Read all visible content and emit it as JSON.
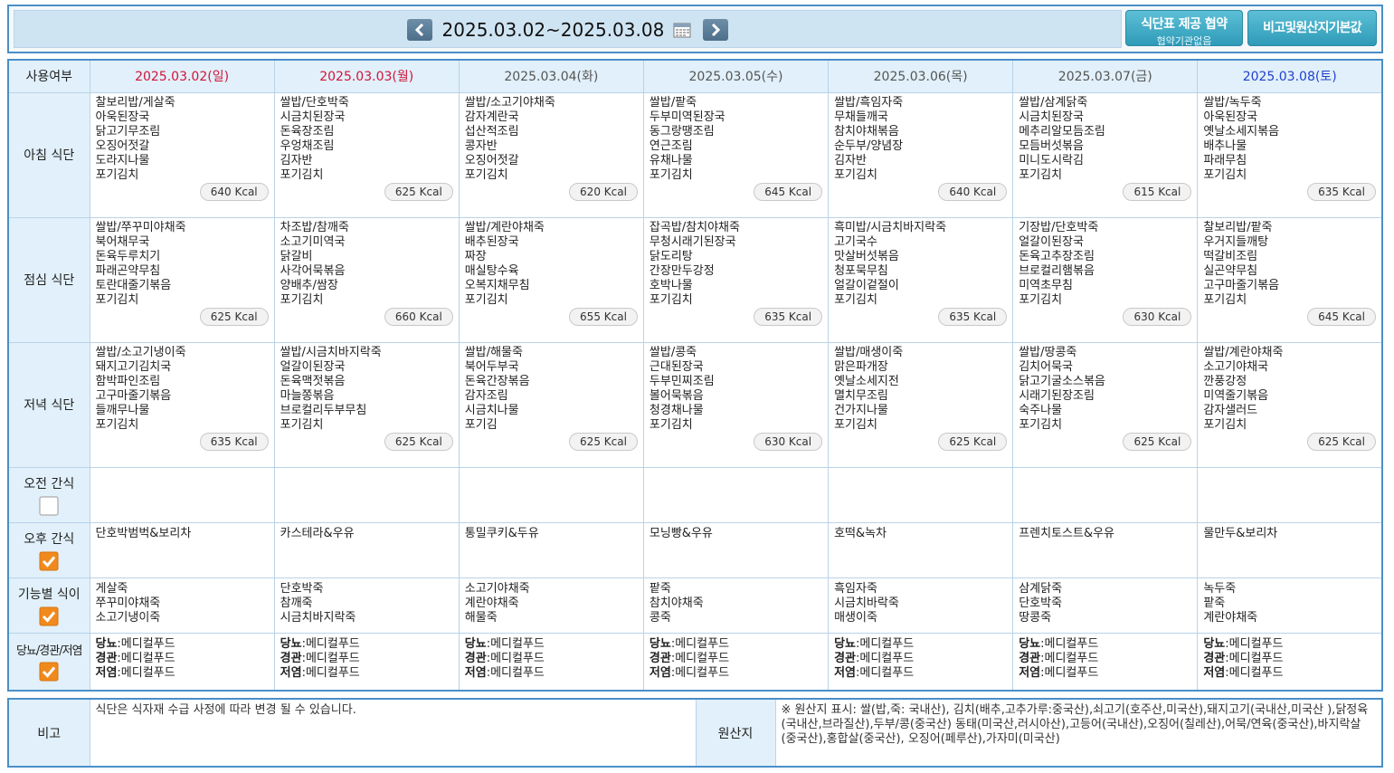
{
  "header": {
    "week_range": "2025.03.02~2025.03.08",
    "agreement_button_title": "식단표 제공 협약",
    "agreement_button_sub": "협약기관없음",
    "origin_default_button": "비고및원산지기본값"
  },
  "table": {
    "usage_label": "사용여부",
    "dates": [
      "2025.03.02(일)",
      "2025.03.03(월)",
      "2025.03.04(화)",
      "2025.03.05(수)",
      "2025.03.06(목)",
      "2025.03.07(금)",
      "2025.03.08(토)"
    ],
    "breakfast": {
      "label": "아침 식단",
      "days": [
        {
          "items": "찰보리밥/게살죽\n아욱된장국\n닭고기무조림\n오징어젓갈\n도라지나물\n포기김치",
          "kcal": "640 Kcal"
        },
        {
          "items": "쌀밥/단호박죽\n시금치된장국\n돈육장조림\n우엉채조림\n김자반\n포기김치",
          "kcal": "625 Kcal"
        },
        {
          "items": "쌀밥/소고기야채죽\n감자계란국\n섭산적조림\n콩자반\n오징어젓갈\n포기김치",
          "kcal": "620 Kcal"
        },
        {
          "items": "쌀밥/팥죽\n두부미역된장국\n동그랑땡조림\n연근조림\n유채나물\n포기김치",
          "kcal": "645 Kcal"
        },
        {
          "items": "쌀밥/흑임자죽\n무채들깨국\n참치야채볶음\n순두부/양념장\n김자반\n포기김치",
          "kcal": "640 Kcal"
        },
        {
          "items": "쌀밥/삼계닭죽\n시금치된장국\n메추리알모듬조림\n모듬버섯볶음\n미니도시락김\n포기김치",
          "kcal": "615 Kcal"
        },
        {
          "items": "쌀밥/녹두죽\n아욱된장국\n옛날소세지볶음\n배추나물\n파래무침\n포기김치",
          "kcal": "635 Kcal"
        }
      ]
    },
    "lunch": {
      "label": "점심 식단",
      "days": [
        {
          "items": "쌀밥/쭈꾸미야채죽\n북어채무국\n돈육두루치기\n파래곤약무침\n토란대줄기볶음\n포기김치",
          "kcal": "625 Kcal"
        },
        {
          "items": "차조밥/참깨죽\n소고기미역국\n닭갈비\n사각어묵볶음\n양배추/쌈장\n포기김치",
          "kcal": "660 Kcal"
        },
        {
          "items": "쌀밥/계란야채죽\n배추된장국\n짜장\n매실탕수육\n오복지채무침\n포기김치",
          "kcal": "655 Kcal"
        },
        {
          "items": "잡곡밥/참치야채죽\n무청시래기된장국\n닭도리탕\n간장만두강정\n호박나물\n포기김치",
          "kcal": "635 Kcal"
        },
        {
          "items": "흑미밥/시금치바지락죽\n고기국수\n맛살버섯볶음\n청포묵무침\n얼갈이겉절이\n포기김치",
          "kcal": "635 Kcal"
        },
        {
          "items": "기장밥/단호박죽\n얼갈이된장국\n돈육고추장조림\n브로컬리햄볶음\n미역초무침\n포기김치",
          "kcal": "630 Kcal"
        },
        {
          "items": "찰보리밥/팥죽\n우거지들깨탕\n떡갈비조림\n실곤약무침\n고구마줄기볶음\n포기김치",
          "kcal": "645 Kcal"
        }
      ]
    },
    "dinner": {
      "label": "저녁 식단",
      "days": [
        {
          "items": "쌀밥/소고기냉이죽\n돼지고기김치국\n함박파인조림\n고구마줄기볶음\n들깨무나물\n포기김치",
          "kcal": "635 Kcal"
        },
        {
          "items": "쌀밥/시금치바지락죽\n얼갈이된장국\n돈육맥젓볶음\n마늘쫑볶음\n브로컬리두부무침\n포기김치",
          "kcal": "625 Kcal"
        },
        {
          "items": "쌀밥/해물죽\n북어두부국\n돈육간장볶음\n감자조림\n시금치나물\n포기김",
          "kcal": "625 Kcal"
        },
        {
          "items": "쌀밥/콩죽\n근대된장국\n두부민찌조림\n볼어묵볶음\n청경채나물\n포기김치",
          "kcal": "630 Kcal"
        },
        {
          "items": "쌀밥/매생이죽\n맑은파개장\n옛날소세지전\n멸치무조림\n건가지나물\n포기김치",
          "kcal": "625 Kcal"
        },
        {
          "items": "쌀밥/땅콩죽\n김치어묵국\n닭고기굴소스볶음\n시래기된장조림\n숙주나물\n포기김치",
          "kcal": "625 Kcal"
        },
        {
          "items": "쌀밥/계란야채죽\n소고기야채국\n깐풍강정\n미역줄기볶음\n감자샐러드\n포기김치",
          "kcal": "625 Kcal"
        }
      ]
    },
    "morning_snack": {
      "label": "오전 간식",
      "checked": false,
      "days": [
        "",
        "",
        "",
        "",
        "",
        "",
        ""
      ]
    },
    "afternoon_snack": {
      "label": "오후 간식",
      "checked": true,
      "days": [
        "단호박범벅&보리차",
        "카스테라&우유",
        "통밀쿠키&두유",
        "모닝빵&우유",
        "호떡&녹차",
        "프렌치토스트&우유",
        "물만두&보리차"
      ]
    },
    "functional": {
      "label": "기능별 식이",
      "checked": true,
      "days": [
        "게살죽\n쭈꾸미야채죽\n소고기냉이죽",
        "단호박죽\n참깨죽\n시금치바지락죽",
        "소고기야채죽\n계란야채죽\n해물죽",
        "팥죽\n참치야채죽\n콩죽",
        "흑임자죽\n시금치바락죽\n매생이죽",
        "삼계닭죽\n단호박죽\n땅콩죽",
        "녹두죽\n팥죽\n계란야채죽"
      ]
    },
    "diet": {
      "label": "당뇨/경관/저염",
      "checked": true,
      "entries": [
        {
          "name": "당뇨",
          "value": ":메디컬푸드"
        },
        {
          "name": "경관",
          "value": ":메디컬푸드"
        },
        {
          "name": "저염",
          "value": ":메디컬푸드"
        }
      ]
    }
  },
  "remarks": {
    "label": "비고",
    "text": "식단은 식자재 수급 사정에 따라 변경 될 수 있습니다.",
    "origin_label": "원산지",
    "origin_text": "※ 원산지 표시: 쌀(밥,죽: 국내산), 김치(배추,고추가루:중국산),쇠고기(호주산,미국산),돼지고기(국내산,미국산 ),닭정육(국내산,브라질산),두부/콩(중국산) 동태(미국산,러시아산),고등어(국내산),오징어(칠레산),어묵/연육(중국산),바지락살(중국산),홍합살(중국산), 오징어(페루산),가자미(미국산)"
  },
  "colors": {
    "border_blue": "#4a8fc9",
    "header_bg": "#e1f0fa",
    "sunday_red": "#d2143a",
    "saturday_blue": "#1f3fd0",
    "check_orange": "#f08a1c",
    "button_teal": "#2f9bb8"
  },
  "icons": {
    "prev": "chevron-left-icon",
    "next": "chevron-right-icon",
    "calendar": "calendar-icon",
    "check": "checkbox-icon"
  }
}
